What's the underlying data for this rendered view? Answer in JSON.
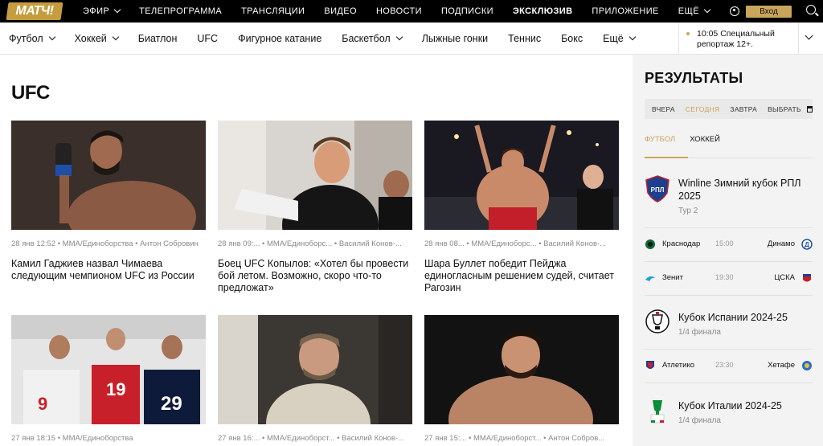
{
  "topbar": {
    "logo": "МАТЧ!",
    "nav": [
      "ЭФИР",
      "ТЕЛЕПРОГРАММА",
      "ТРАНСЛЯЦИИ",
      "ВИДЕО",
      "НОВОСТИ",
      "ПОДПИСКИ",
      "ЭКСКЛЮЗИВ",
      "ПРИЛОЖЕНИЕ",
      "ЕЩЁ"
    ],
    "login": "Вход"
  },
  "sports_nav": [
    "Футбол",
    "Хоккей",
    "Биатлон",
    "UFC",
    "Фигурное катание",
    "Баскетбол",
    "Лыжные гонки",
    "Теннис",
    "Бокс",
    "Ещё"
  ],
  "live_teaser": {
    "line1": "10:05 Специальный",
    "line2": "репортаж 12+."
  },
  "page": {
    "title": "UFC"
  },
  "articles": [
    {
      "meta": "28 янв 12:52 • ММА/Единоборства • Антон Собровин",
      "title": "Камил Гаджиев назвал Чимаева следующим чемпионом UFC из России"
    },
    {
      "meta": "28 янв 09:... • ММА/Единоборс... • Василий Конов-...",
      "title": "Боец UFC Копылов: «Хотел бы провести бой летом. Возможно, скоро что-то предложат»"
    },
    {
      "meta": "28 янв 08... • ММА/Единоборс... • Василий Конов-...",
      "title": "Шара Буллет победит Пейджа единогласным решением судей, считает Рагозин"
    },
    {
      "meta": "27 янв 18:15 • ММА/Единоборства",
      "title": ""
    },
    {
      "meta": "27 янв 16:... • ММА/Единоборст... • Василий Конов-...",
      "title": ""
    },
    {
      "meta": "27 янв 15:... • ММА/Единоборст... • Антон Собров...",
      "title": ""
    }
  ],
  "sidebar": {
    "title": "РЕЗУЛЬТАТЫ",
    "day_tabs": [
      "ВЧЕРА",
      "СЕГОДНЯ",
      "ЗАВТРА",
      "ВЫБРАТЬ"
    ],
    "sport_tabs": [
      "ФУТБОЛ",
      "ХОККЕЙ"
    ],
    "tournaments": [
      {
        "name": "Winline Зимний кубок РПЛ 2025",
        "round": "Тур 2",
        "matches": [
          {
            "home": "Краснодар",
            "time": "15:00",
            "away": "Динамо"
          },
          {
            "home": "Зенит",
            "time": "19:30",
            "away": "ЦСКА"
          }
        ]
      },
      {
        "name": "Кубок Испании 2024-25",
        "round": "1/4 финала",
        "matches": [
          {
            "home": "Атлетико",
            "time": "23:30",
            "away": "Хетафе"
          }
        ]
      },
      {
        "name": "Кубок Италии 2024-25",
        "round": "1/4 финала",
        "matches": []
      }
    ]
  },
  "colors": {
    "accent": "#c9a55c",
    "topbar": "#000000",
    "sidebar_bg": "#f3f3f3"
  }
}
